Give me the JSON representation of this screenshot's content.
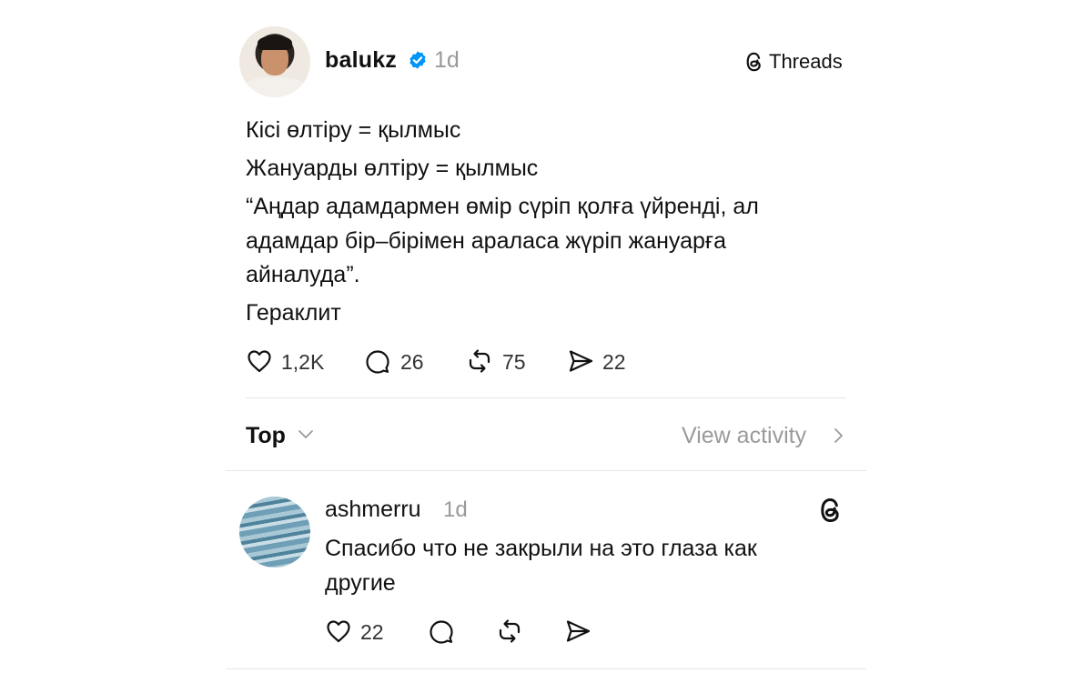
{
  "post": {
    "username": "balukz",
    "time": "1d",
    "brand": "Threads",
    "lines": [
      "Кісі өлтіру = қылмыс",
      "Жануарды өлтіру = қылмыс",
      "“Аңдар адамдармен өмір сүріп қолға үйренді, ал",
      "адамдар бір–бірімен араласа жүріп жануарға",
      "айналуда”.",
      "Гераклит"
    ],
    "stats": {
      "likes": "1,2K",
      "replies": "26",
      "reposts": "75",
      "shares": "22"
    }
  },
  "replies_header": {
    "sort": "Top",
    "view_activity": "View activity"
  },
  "reply": {
    "username": "ashmerru",
    "time": "1d",
    "lines": [
      "Спасибо что не закрыли на это глаза как",
      "другие"
    ],
    "likes": "22"
  },
  "icons": {
    "verified": "verified-badge-icon",
    "threads": "threads-logo-icon",
    "like": "heart-icon",
    "reply": "comment-icon",
    "repost": "repost-icon",
    "share": "send-icon"
  },
  "colors": {
    "verified": "#0095f6",
    "muted": "#9a9a9a"
  }
}
